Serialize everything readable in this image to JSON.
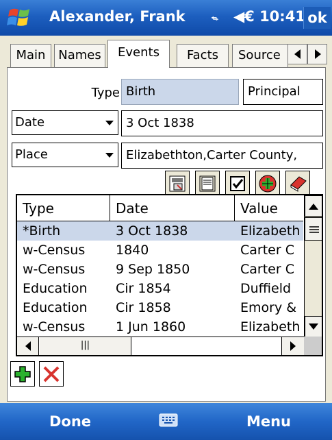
{
  "titlebar": {
    "title": "Alexander, Frank",
    "time": "◀€ 10:41",
    "ok": "ok"
  },
  "tabs": [
    "Main",
    "Names",
    "Events",
    "Facts",
    "Source"
  ],
  "active_tab": "Events",
  "form": {
    "type_label": "Type",
    "type_value": "Birth",
    "role_value": "Principal",
    "date_selector": "Date",
    "date_value": "3 Oct 1838",
    "place_selector": "Place",
    "place_value": "Elizabethton,Carter County,"
  },
  "list": {
    "columns": [
      "Type",
      "Date",
      "Value"
    ],
    "rows": [
      {
        "type": "*Birth",
        "date": "3 Oct 1838",
        "value": "Elizabeth"
      },
      {
        "type": "w-Census",
        "date": "1840",
        "value": "Carter C"
      },
      {
        "type": "w-Census",
        "date": "9 Sep 1850",
        "value": "Carter C"
      },
      {
        "type": "Education",
        "date": "Cir 1854",
        "value": "Duffield"
      },
      {
        "type": "Education",
        "date": "Cir 1858",
        "value": "Emory &"
      },
      {
        "type": "w-Census",
        "date": "1 Jun 1860",
        "value": "Elizabeth"
      }
    ],
    "selected_row": 0,
    "hscroll_thumb_label": "|||"
  },
  "menubar": {
    "left": "Done",
    "right": "Menu"
  },
  "colors": {
    "titlebar": "#1d5fbf",
    "selection": "#cbd7ea",
    "frame": "#ece9d8"
  }
}
